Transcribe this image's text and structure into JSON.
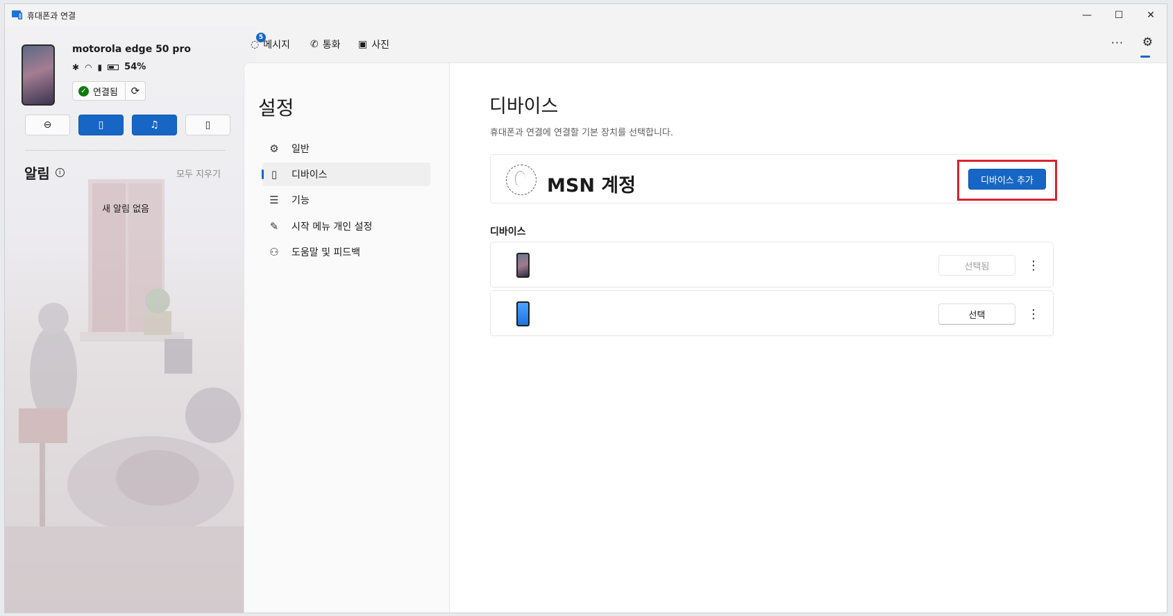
{
  "window": {
    "title": "휴대폰과 연결",
    "controls": {
      "minimize": "—",
      "maximize": "☐",
      "close": "✕"
    }
  },
  "phone": {
    "name": "motorola edge 50 pro",
    "battery": "54%",
    "connection_status": "연결됨"
  },
  "notifications": {
    "title": "알림",
    "clear_all": "모두 지우기",
    "empty": "새 알림 없음"
  },
  "topnav": {
    "messages": {
      "label": "메시지",
      "badge": "5"
    },
    "calls": {
      "label": "통화"
    },
    "photos": {
      "label": "사진"
    },
    "more": "···"
  },
  "settings": {
    "title": "설정",
    "nav": [
      {
        "label": "일반",
        "icon": "gear-icon"
      },
      {
        "label": "디바이스",
        "icon": "phone-icon"
      },
      {
        "label": "기능",
        "icon": "list-icon"
      },
      {
        "label": "시작 메뉴 개인 설정",
        "icon": "pen-icon"
      },
      {
        "label": "도움말 및 피드백",
        "icon": "people-icon"
      }
    ]
  },
  "devices_page": {
    "title": "디바이스",
    "description": "휴대폰과 연결에 연결할 기본 장치를 선택합니다.",
    "account": {
      "name": "MSN 계정",
      "add_button": "디바이스 추가"
    },
    "devices_heading": "디바이스",
    "devices": [
      {
        "button": "선택됨",
        "selected": true
      },
      {
        "button": "선택",
        "selected": false
      }
    ]
  },
  "colors": {
    "accent": "#1766c5",
    "highlight": "#d9222e",
    "connected": "#0f7b0f"
  }
}
